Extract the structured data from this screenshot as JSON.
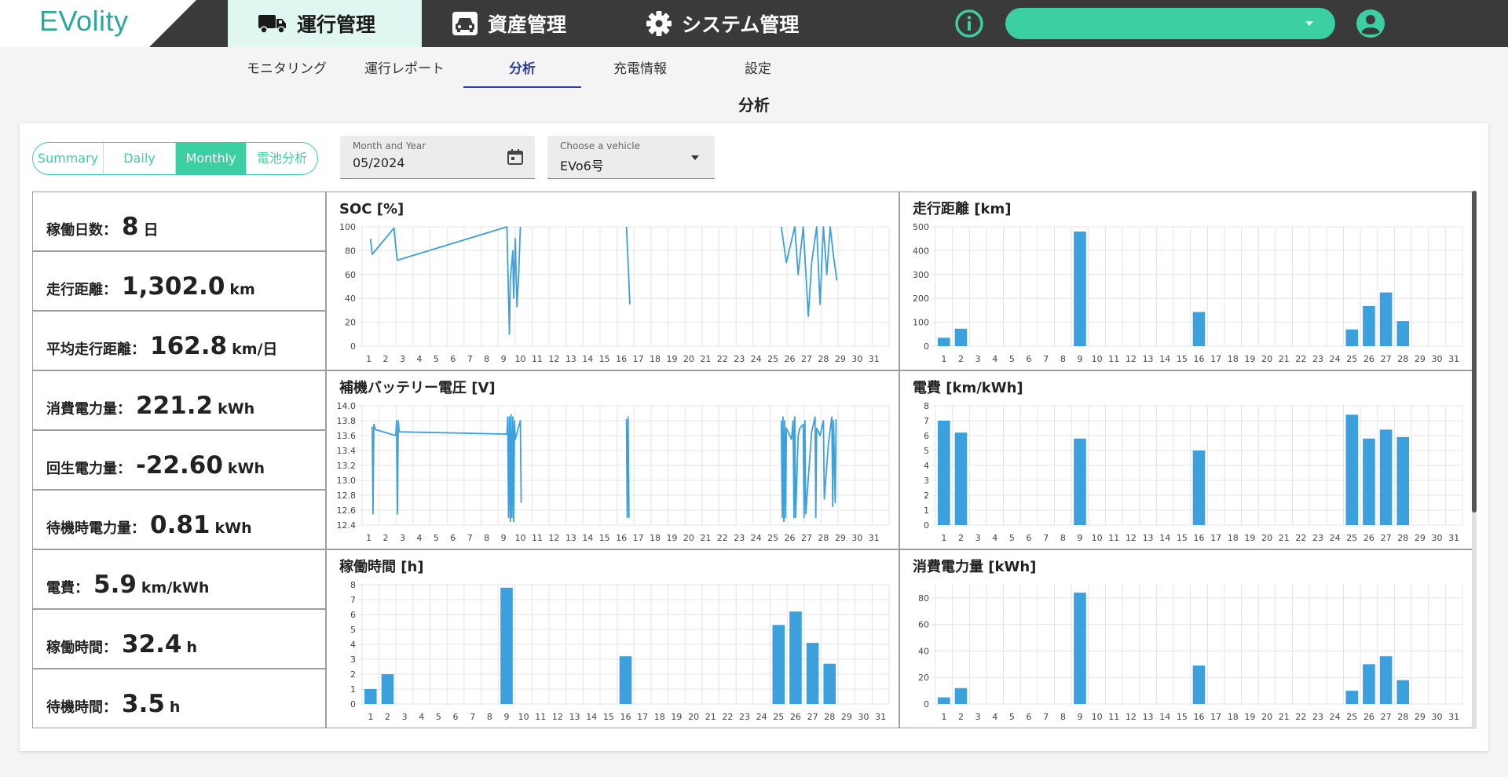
{
  "app": {
    "logo": "EVolity",
    "nav": [
      {
        "label": "運行管理",
        "icon": "truck-icon",
        "active": true
      },
      {
        "label": "資産管理",
        "icon": "car-icon",
        "active": false
      },
      {
        "label": "システム管理",
        "icon": "gear-icon",
        "active": false
      }
    ],
    "accent": "#3ccfa3",
    "vehicle_select_value": ""
  },
  "subnav": [
    {
      "label": "モニタリング",
      "active": false
    },
    {
      "label": "運行レポート",
      "active": false
    },
    {
      "label": "分析",
      "active": true
    },
    {
      "label": "充電情報",
      "active": false
    },
    {
      "label": "設定",
      "active": false
    }
  ],
  "page_title": "分析",
  "modes": [
    {
      "label": "Summary",
      "active": false
    },
    {
      "label": "Daily",
      "active": false
    },
    {
      "label": "Monthly",
      "active": true
    },
    {
      "label": "電池分析",
      "active": false
    }
  ],
  "month_field": {
    "label": "Month and Year",
    "value": "05/2024"
  },
  "vehicle_field": {
    "label": "Choose a vehicle",
    "value": "EVo6号"
  },
  "stats": [
    {
      "label": "稼働日数：",
      "value": "8",
      "unit": "日"
    },
    {
      "label": "走行距離：",
      "value": "1,302.0",
      "unit": "km"
    },
    {
      "label": "平均走行距離：",
      "value": "162.8",
      "unit": "km/日"
    },
    {
      "label": "消費電力量：",
      "value": "221.2",
      "unit": "kWh"
    },
    {
      "label": "回生電力量：",
      "value": "-22.60",
      "unit": "kWh"
    },
    {
      "label": "待機時電力量：",
      "value": "0.81",
      "unit": "kWh"
    },
    {
      "label": "電費：",
      "value": "5.9",
      "unit": "km/kWh"
    },
    {
      "label": "稼働時間：",
      "value": "32.4",
      "unit": "h"
    },
    {
      "label": "待機時間：",
      "value": "3.5",
      "unit": "h"
    }
  ],
  "chart_data": [
    {
      "id": "soc",
      "type": "line",
      "title": "SOC [%]",
      "ylim": [
        0,
        100
      ],
      "yticks": [
        0,
        20,
        40,
        60,
        80,
        100
      ],
      "xlim": [
        0.6,
        31.9
      ],
      "x_ticks": [
        "1",
        "2",
        "3",
        "4",
        "5",
        "6",
        "7",
        "8",
        "9",
        "10",
        "11",
        "12",
        "13",
        "14",
        "15",
        "16",
        "17",
        "18",
        "19",
        "20",
        "21",
        "22",
        "23",
        "24",
        "25",
        "26",
        "27",
        "28",
        "29",
        "30",
        "31"
      ],
      "grid": true,
      "series": [
        {
          "points": [
            [
              1.1,
              90
            ],
            [
              1.2,
              77
            ],
            [
              2.5,
              99
            ],
            [
              2.6,
              83
            ],
            [
              2.7,
              72
            ],
            [
              9.2,
              100
            ],
            [
              9.3,
              40
            ],
            [
              9.35,
              10
            ],
            [
              9.4,
              55
            ],
            [
              9.55,
              80
            ],
            [
              9.6,
              40
            ],
            [
              9.7,
              90
            ],
            [
              9.8,
              33
            ],
            [
              9.9,
              60
            ],
            [
              10.0,
              100
            ]
          ]
        },
        {
          "points": [
            [
              16.3,
              100
            ],
            [
              16.4,
              70
            ],
            [
              16.5,
              35
            ]
          ]
        },
        {
          "points": [
            [
              25.5,
              100
            ],
            [
              25.8,
              70
            ],
            [
              26.3,
              100
            ],
            [
              26.5,
              60
            ],
            [
              26.8,
              100
            ],
            [
              27.1,
              25
            ],
            [
              27.3,
              70
            ],
            [
              27.6,
              100
            ],
            [
              27.8,
              35
            ],
            [
              28.0,
              100
            ],
            [
              28.2,
              60
            ],
            [
              28.4,
              100
            ],
            [
              28.6,
              75
            ],
            [
              28.8,
              55
            ]
          ]
        }
      ]
    },
    {
      "id": "distance",
      "type": "bar",
      "title": "走行距離 [km]",
      "ylim": [
        0,
        500
      ],
      "yticks": [
        0,
        100,
        200,
        300,
        400,
        500
      ],
      "grid": true,
      "categories": [
        "1",
        "2",
        "3",
        "4",
        "5",
        "6",
        "7",
        "8",
        "9",
        "10",
        "11",
        "12",
        "13",
        "14",
        "15",
        "16",
        "17",
        "18",
        "19",
        "20",
        "21",
        "22",
        "23",
        "24",
        "25",
        "26",
        "27",
        "28",
        "29",
        "30",
        "31"
      ],
      "values": [
        35,
        73,
        0,
        0,
        0,
        0,
        0,
        0,
        480,
        0,
        0,
        0,
        0,
        0,
        0,
        143,
        0,
        0,
        0,
        0,
        0,
        0,
        0,
        0,
        70,
        168,
        225,
        105,
        0,
        0,
        0
      ]
    },
    {
      "id": "voltage",
      "type": "line",
      "title": "補機バッテリー電圧 [V]",
      "ylim": [
        12.4,
        14.0
      ],
      "yticks": [
        12.4,
        12.6,
        12.8,
        13.0,
        13.2,
        13.4,
        13.6,
        13.8,
        14.0
      ],
      "xlim": [
        0.6,
        31.9
      ],
      "x_ticks": [
        "1",
        "2",
        "3",
        "4",
        "5",
        "6",
        "7",
        "8",
        "9",
        "10",
        "11",
        "12",
        "13",
        "14",
        "15",
        "16",
        "17",
        "18",
        "19",
        "20",
        "21",
        "22",
        "23",
        "24",
        "25",
        "26",
        "27",
        "28",
        "29",
        "30",
        "31"
      ],
      "grid": true,
      "series": [
        {
          "points": [
            [
              1.2,
              13.72
            ],
            [
              1.25,
              12.55
            ],
            [
              1.3,
              13.75
            ],
            [
              1.4,
              13.68
            ],
            [
              2.6,
              13.6
            ],
            [
              2.65,
              13.8
            ],
            [
              2.7,
              12.55
            ],
            [
              2.75,
              13.8
            ],
            [
              2.8,
              13.65
            ],
            [
              9.2,
              13.62
            ],
            [
              9.25,
              13.85
            ],
            [
              9.3,
              12.5
            ],
            [
              9.35,
              13.85
            ],
            [
              9.4,
              12.45
            ],
            [
              9.45,
              13.88
            ],
            [
              9.5,
              12.5
            ],
            [
              9.55,
              13.85
            ],
            [
              9.6,
              12.45
            ],
            [
              9.65,
              13.8
            ],
            [
              9.7,
              13.55
            ],
            [
              10.0,
              13.8
            ],
            [
              10.05,
              12.7
            ]
          ]
        },
        {
          "points": [
            [
              16.3,
              13.82
            ],
            [
              16.35,
              12.5
            ],
            [
              16.4,
              13.85
            ],
            [
              16.45,
              12.5
            ]
          ]
        },
        {
          "points": [
            [
              25.5,
              13.8
            ],
            [
              25.55,
              12.5
            ],
            [
              25.6,
              13.85
            ],
            [
              25.65,
              12.45
            ],
            [
              25.7,
              13.8
            ],
            [
              25.75,
              12.5
            ],
            [
              25.8,
              13.7
            ],
            [
              26.1,
              13.55
            ],
            [
              26.2,
              13.8
            ],
            [
              26.25,
              12.5
            ],
            [
              26.3,
              13.85
            ],
            [
              26.35,
              12.5
            ],
            [
              26.5,
              13.6
            ],
            [
              26.6,
              13.7
            ],
            [
              26.8,
              13.75
            ],
            [
              26.85,
              12.5
            ],
            [
              26.9,
              13.8
            ],
            [
              26.95,
              12.55
            ],
            [
              27.3,
              13.65
            ],
            [
              27.5,
              13.85
            ],
            [
              27.55,
              12.5
            ],
            [
              27.6,
              13.7
            ],
            [
              27.8,
              13.6
            ],
            [
              28.0,
              13.8
            ],
            [
              28.05,
              12.75
            ],
            [
              28.3,
              13.5
            ],
            [
              28.5,
              13.85
            ],
            [
              28.55,
              12.65
            ],
            [
              28.6,
              13.8
            ],
            [
              28.7,
              12.7
            ],
            [
              28.75,
              13.82
            ]
          ]
        }
      ]
    },
    {
      "id": "efficiency",
      "type": "bar",
      "title": "電費 [km/kWh]",
      "ylim": [
        0,
        8
      ],
      "yticks": [
        0,
        1,
        2,
        3,
        4,
        5,
        6,
        7,
        8
      ],
      "grid": true,
      "categories": [
        "1",
        "2",
        "3",
        "4",
        "5",
        "6",
        "7",
        "8",
        "9",
        "10",
        "11",
        "12",
        "13",
        "14",
        "15",
        "16",
        "17",
        "18",
        "19",
        "20",
        "21",
        "22",
        "23",
        "24",
        "25",
        "26",
        "27",
        "28",
        "29",
        "30",
        "31"
      ],
      "values": [
        7.0,
        6.2,
        0,
        0,
        0,
        0,
        0,
        0,
        5.8,
        0,
        0,
        0,
        0,
        0,
        0,
        5.0,
        0,
        0,
        0,
        0,
        0,
        0,
        0,
        0,
        7.4,
        5.8,
        6.4,
        5.9,
        0,
        0,
        0
      ]
    },
    {
      "id": "hours",
      "type": "bar",
      "title": "稼働時間 [h]",
      "ylim": [
        0,
        8
      ],
      "yticks": [
        0,
        1,
        2,
        3,
        4,
        5,
        6,
        7,
        8
      ],
      "grid": true,
      "categories": [
        "1",
        "2",
        "3",
        "4",
        "5",
        "6",
        "7",
        "8",
        "9",
        "10",
        "11",
        "12",
        "13",
        "14",
        "15",
        "16",
        "17",
        "18",
        "19",
        "20",
        "21",
        "22",
        "23",
        "24",
        "25",
        "26",
        "27",
        "28",
        "29",
        "30",
        "31"
      ],
      "values": [
        1.0,
        2.0,
        0,
        0,
        0,
        0,
        0,
        0,
        7.8,
        0,
        0,
        0,
        0,
        0,
        0,
        3.2,
        0,
        0,
        0,
        0,
        0,
        0,
        0,
        0,
        5.3,
        6.2,
        4.1,
        2.7,
        0,
        0,
        0
      ]
    },
    {
      "id": "energy",
      "type": "bar",
      "title": "消費電力量 [kWh]",
      "ylim": [
        0,
        90
      ],
      "yticks": [
        0,
        20,
        40,
        60,
        80
      ],
      "grid": true,
      "categories": [
        "1",
        "2",
        "3",
        "4",
        "5",
        "6",
        "7",
        "8",
        "9",
        "10",
        "11",
        "12",
        "13",
        "14",
        "15",
        "16",
        "17",
        "18",
        "19",
        "20",
        "21",
        "22",
        "23",
        "24",
        "25",
        "26",
        "27",
        "28",
        "29",
        "30",
        "31"
      ],
      "values": [
        5,
        12,
        0,
        0,
        0,
        0,
        0,
        0,
        84,
        0,
        0,
        0,
        0,
        0,
        0,
        29,
        0,
        0,
        0,
        0,
        0,
        0,
        0,
        0,
        10,
        30,
        36,
        18,
        0,
        0,
        0
      ]
    }
  ],
  "chart_color": "#3ba0dc"
}
